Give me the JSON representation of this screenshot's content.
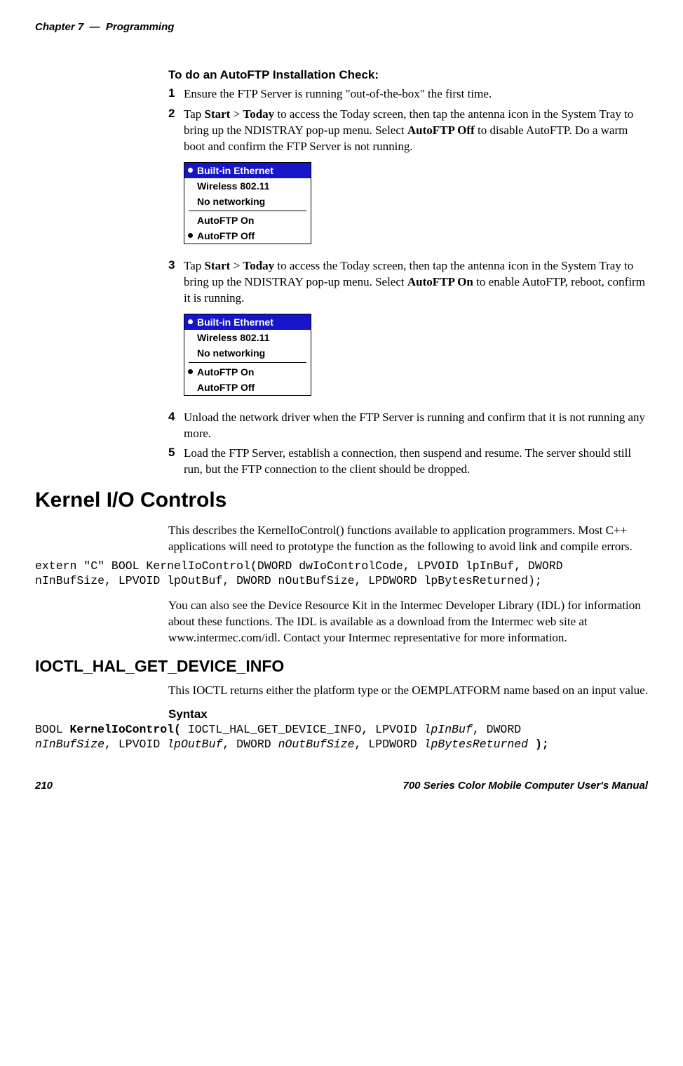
{
  "header": {
    "chapter": "Chapter 7",
    "sep": "—",
    "title": "Programming"
  },
  "footer": {
    "page": "210",
    "manual": "700 Series Color Mobile Computer User's Manual"
  },
  "section1": {
    "heading": "To do an AutoFTP Installation Check:",
    "items": {
      "1": {
        "num": "1",
        "text_a": "Ensure the FTP Server is running \"out-of-the-box\" the first time."
      },
      "2": {
        "num": "2",
        "text_a": "Tap ",
        "b1": "Start",
        "text_b": " > ",
        "b2": "Today",
        "text_c": " to access the Today screen, then tap the antenna icon in the System Tray to bring up the NDISTRAY pop-up menu. Select ",
        "b3": "AutoFTP Off",
        "text_d": " to disable AutoFTP. Do a warm boot and confirm the FTP Server is not running."
      },
      "3": {
        "num": "3",
        "text_a": "Tap ",
        "b1": "Start",
        "text_b": " > ",
        "b2": "Today",
        "text_c": " to access the Today screen, then tap the antenna icon in the System Tray to bring up the NDISTRAY pop-up menu. Select ",
        "b3": "AutoFTP On",
        "text_d": " to enable AutoFTP, reboot, confirm it is running."
      },
      "4": {
        "num": "4",
        "text_a": "Unload the network driver when the FTP Server is running and confirm that it is not running any more."
      },
      "5": {
        "num": "5",
        "text_a": "Load the FTP Server, establish a connection, then suspend and resume. The server should still run, but the FTP connection to the client should be dropped."
      }
    }
  },
  "menu1": {
    "title": "Built-in Ethernet",
    "item1": "Wireless 802.11",
    "item2": "No networking",
    "item3": "AutoFTP On",
    "item4": "AutoFTP Off"
  },
  "menu2": {
    "title": "Built-in Ethernet",
    "item1": "Wireless 802.11",
    "item2": "No networking",
    "item3": "AutoFTP On",
    "item4": "AutoFTP Off"
  },
  "kernel": {
    "heading": "Kernel I/O Controls",
    "para1": "This describes the KernelIoControl() functions available to application programmers. Most C++ applications will need to prototype the function as the following to avoid link and compile errors.",
    "code1": "extern \"C\" BOOL KernelIoControl(DWORD dwIoControlCode, LPVOID lpInBuf, DWORD\nnInBufSize, LPVOID lpOutBuf, DWORD nOutBufSize, LPDWORD lpBytesReturned);",
    "para2": "You can also see the Device Resource Kit in the Intermec Developer Library (IDL) for information about these functions. The IDL is available as a download from the Intermec web site at www.intermec.com/idl. Contact your Intermec representative for more information."
  },
  "ioctl": {
    "heading": "IOCTL_HAL_GET_DEVICE_INFO",
    "para": "This IOCTL returns either the platform type or the OEMPLATFORM name based on an input value.",
    "syntax_label": "Syntax",
    "syntax": {
      "p1": "BOOL ",
      "b1": "KernelIoControl( ",
      "p2": "IOCTL_HAL_GET_DEVICE_INFO, LPVOID ",
      "i1": "lpInBuf",
      "p3": ", DWORD\n",
      "i2": "nInBufSize",
      "p4": ", LPVOID ",
      "i3": "lpOutBuf",
      "p5": ", DWORD ",
      "i4": "nOutBufSize",
      "p6": ", LPDWORD ",
      "i5": "lpBytesReturned",
      "p7": " ",
      "b2": ");"
    }
  }
}
